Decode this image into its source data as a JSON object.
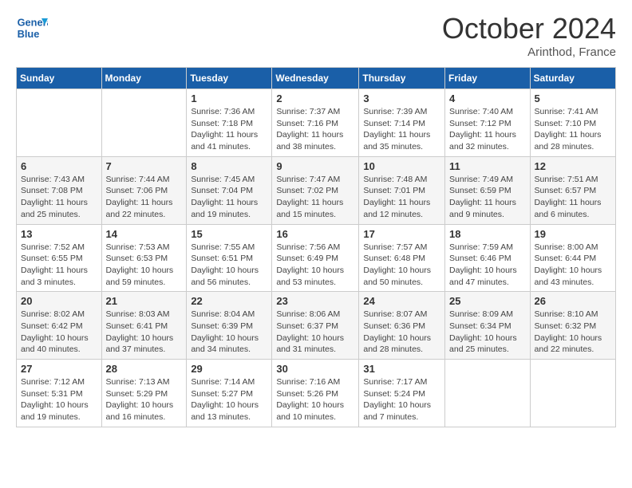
{
  "header": {
    "logo_text_line1": "General",
    "logo_text_line2": "Blue",
    "month_title": "October 2024",
    "subtitle": "Arinthod, France"
  },
  "weekdays": [
    "Sunday",
    "Monday",
    "Tuesday",
    "Wednesday",
    "Thursday",
    "Friday",
    "Saturday"
  ],
  "weeks": [
    [
      {
        "day": "",
        "sunrise": "",
        "sunset": "",
        "daylight": ""
      },
      {
        "day": "",
        "sunrise": "",
        "sunset": "",
        "daylight": ""
      },
      {
        "day": "1",
        "sunrise": "Sunrise: 7:36 AM",
        "sunset": "Sunset: 7:18 PM",
        "daylight": "Daylight: 11 hours and 41 minutes."
      },
      {
        "day": "2",
        "sunrise": "Sunrise: 7:37 AM",
        "sunset": "Sunset: 7:16 PM",
        "daylight": "Daylight: 11 hours and 38 minutes."
      },
      {
        "day": "3",
        "sunrise": "Sunrise: 7:39 AM",
        "sunset": "Sunset: 7:14 PM",
        "daylight": "Daylight: 11 hours and 35 minutes."
      },
      {
        "day": "4",
        "sunrise": "Sunrise: 7:40 AM",
        "sunset": "Sunset: 7:12 PM",
        "daylight": "Daylight: 11 hours and 32 minutes."
      },
      {
        "day": "5",
        "sunrise": "Sunrise: 7:41 AM",
        "sunset": "Sunset: 7:10 PM",
        "daylight": "Daylight: 11 hours and 28 minutes."
      }
    ],
    [
      {
        "day": "6",
        "sunrise": "Sunrise: 7:43 AM",
        "sunset": "Sunset: 7:08 PM",
        "daylight": "Daylight: 11 hours and 25 minutes."
      },
      {
        "day": "7",
        "sunrise": "Sunrise: 7:44 AM",
        "sunset": "Sunset: 7:06 PM",
        "daylight": "Daylight: 11 hours and 22 minutes."
      },
      {
        "day": "8",
        "sunrise": "Sunrise: 7:45 AM",
        "sunset": "Sunset: 7:04 PM",
        "daylight": "Daylight: 11 hours and 19 minutes."
      },
      {
        "day": "9",
        "sunrise": "Sunrise: 7:47 AM",
        "sunset": "Sunset: 7:02 PM",
        "daylight": "Daylight: 11 hours and 15 minutes."
      },
      {
        "day": "10",
        "sunrise": "Sunrise: 7:48 AM",
        "sunset": "Sunset: 7:01 PM",
        "daylight": "Daylight: 11 hours and 12 minutes."
      },
      {
        "day": "11",
        "sunrise": "Sunrise: 7:49 AM",
        "sunset": "Sunset: 6:59 PM",
        "daylight": "Daylight: 11 hours and 9 minutes."
      },
      {
        "day": "12",
        "sunrise": "Sunrise: 7:51 AM",
        "sunset": "Sunset: 6:57 PM",
        "daylight": "Daylight: 11 hours and 6 minutes."
      }
    ],
    [
      {
        "day": "13",
        "sunrise": "Sunrise: 7:52 AM",
        "sunset": "Sunset: 6:55 PM",
        "daylight": "Daylight: 11 hours and 3 minutes."
      },
      {
        "day": "14",
        "sunrise": "Sunrise: 7:53 AM",
        "sunset": "Sunset: 6:53 PM",
        "daylight": "Daylight: 10 hours and 59 minutes."
      },
      {
        "day": "15",
        "sunrise": "Sunrise: 7:55 AM",
        "sunset": "Sunset: 6:51 PM",
        "daylight": "Daylight: 10 hours and 56 minutes."
      },
      {
        "day": "16",
        "sunrise": "Sunrise: 7:56 AM",
        "sunset": "Sunset: 6:49 PM",
        "daylight": "Daylight: 10 hours and 53 minutes."
      },
      {
        "day": "17",
        "sunrise": "Sunrise: 7:57 AM",
        "sunset": "Sunset: 6:48 PM",
        "daylight": "Daylight: 10 hours and 50 minutes."
      },
      {
        "day": "18",
        "sunrise": "Sunrise: 7:59 AM",
        "sunset": "Sunset: 6:46 PM",
        "daylight": "Daylight: 10 hours and 47 minutes."
      },
      {
        "day": "19",
        "sunrise": "Sunrise: 8:00 AM",
        "sunset": "Sunset: 6:44 PM",
        "daylight": "Daylight: 10 hours and 43 minutes."
      }
    ],
    [
      {
        "day": "20",
        "sunrise": "Sunrise: 8:02 AM",
        "sunset": "Sunset: 6:42 PM",
        "daylight": "Daylight: 10 hours and 40 minutes."
      },
      {
        "day": "21",
        "sunrise": "Sunrise: 8:03 AM",
        "sunset": "Sunset: 6:41 PM",
        "daylight": "Daylight: 10 hours and 37 minutes."
      },
      {
        "day": "22",
        "sunrise": "Sunrise: 8:04 AM",
        "sunset": "Sunset: 6:39 PM",
        "daylight": "Daylight: 10 hours and 34 minutes."
      },
      {
        "day": "23",
        "sunrise": "Sunrise: 8:06 AM",
        "sunset": "Sunset: 6:37 PM",
        "daylight": "Daylight: 10 hours and 31 minutes."
      },
      {
        "day": "24",
        "sunrise": "Sunrise: 8:07 AM",
        "sunset": "Sunset: 6:36 PM",
        "daylight": "Daylight: 10 hours and 28 minutes."
      },
      {
        "day": "25",
        "sunrise": "Sunrise: 8:09 AM",
        "sunset": "Sunset: 6:34 PM",
        "daylight": "Daylight: 10 hours and 25 minutes."
      },
      {
        "day": "26",
        "sunrise": "Sunrise: 8:10 AM",
        "sunset": "Sunset: 6:32 PM",
        "daylight": "Daylight: 10 hours and 22 minutes."
      }
    ],
    [
      {
        "day": "27",
        "sunrise": "Sunrise: 7:12 AM",
        "sunset": "Sunset: 5:31 PM",
        "daylight": "Daylight: 10 hours and 19 minutes."
      },
      {
        "day": "28",
        "sunrise": "Sunrise: 7:13 AM",
        "sunset": "Sunset: 5:29 PM",
        "daylight": "Daylight: 10 hours and 16 minutes."
      },
      {
        "day": "29",
        "sunrise": "Sunrise: 7:14 AM",
        "sunset": "Sunset: 5:27 PM",
        "daylight": "Daylight: 10 hours and 13 minutes."
      },
      {
        "day": "30",
        "sunrise": "Sunrise: 7:16 AM",
        "sunset": "Sunset: 5:26 PM",
        "daylight": "Daylight: 10 hours and 10 minutes."
      },
      {
        "day": "31",
        "sunrise": "Sunrise: 7:17 AM",
        "sunset": "Sunset: 5:24 PM",
        "daylight": "Daylight: 10 hours and 7 minutes."
      },
      {
        "day": "",
        "sunrise": "",
        "sunset": "",
        "daylight": ""
      },
      {
        "day": "",
        "sunrise": "",
        "sunset": "",
        "daylight": ""
      }
    ]
  ]
}
